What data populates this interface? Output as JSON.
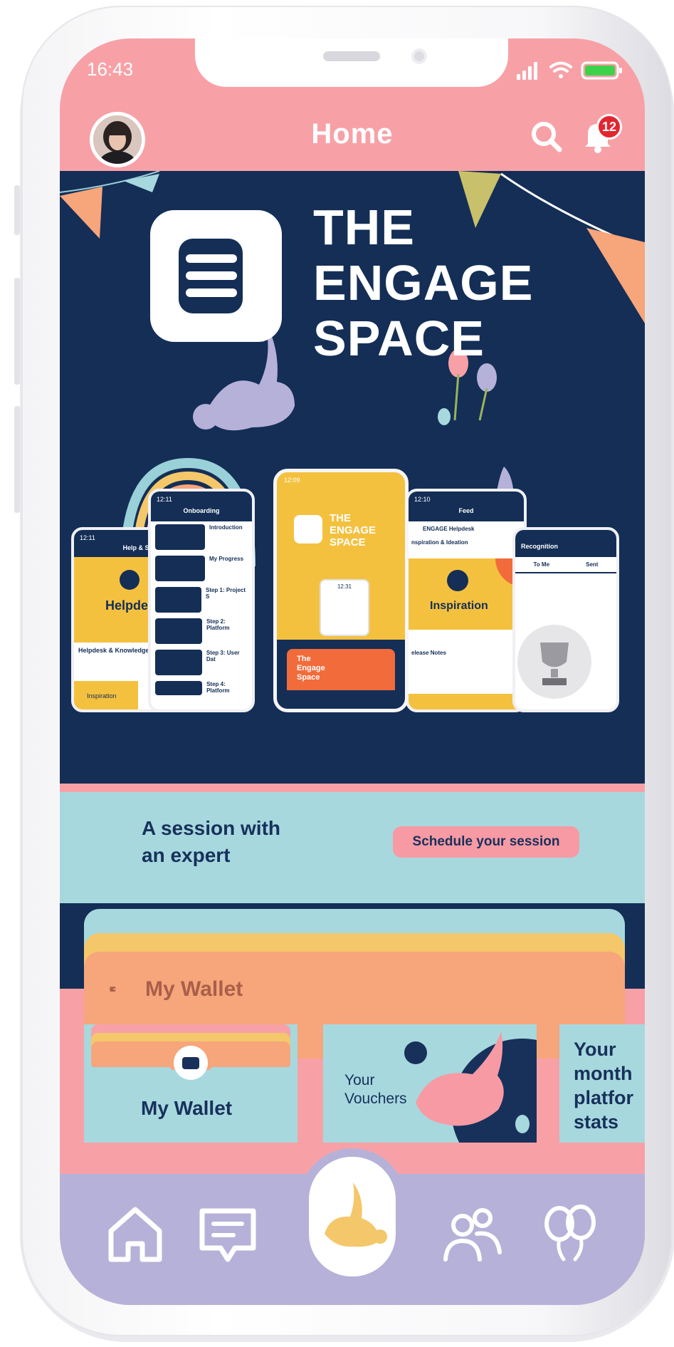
{
  "status_bar": {
    "time": "16:43"
  },
  "header": {
    "title": "Home",
    "notification_count": "12"
  },
  "banner": {
    "brand_line1": "THE",
    "brand_line2": "ENGAGE",
    "brand_line3": "SPACE",
    "mock_screens": {
      "help_title": "Help & Support",
      "help_hero": "Helpdesk",
      "help_item": "Helpdesk & Knowledge Ba",
      "help_footer": "Inspiration",
      "onboarding_title": "Onboarding",
      "onboarding_items": [
        "Introduction",
        "My Progress",
        "Step 1: Project S",
        "Step 2: Platform",
        "Step 3: User Dat",
        "Step 4: Platform"
      ],
      "center_times": [
        "12:09",
        "12:31"
      ],
      "center_brand": [
        "THE",
        "ENGAGE",
        "SPACE"
      ],
      "center_card": [
        "The",
        "Engage",
        "Space"
      ],
      "feed_title": "Feed",
      "feed_author": "ENGAGE Helpdesk",
      "feed_heading": "nspiration & Ideation",
      "feed_hero": "Inspiration",
      "feed_note": "elease Notes",
      "recognition_title": "Recognition",
      "recognition_tabs": [
        "To Me",
        "Sent"
      ],
      "mock_times": [
        "12:11",
        "12:11",
        "12:10"
      ]
    }
  },
  "session": {
    "text_line1": "A session with",
    "text_line2": "an expert",
    "button": "Schedule your session"
  },
  "wallet": {
    "heading": "My Wallet",
    "tiles": [
      {
        "label": "My Wallet"
      },
      {
        "label_line1": "Your",
        "label_line2": "Vouchers"
      },
      {
        "label_line1": "Your",
        "label_line2": "month",
        "label_line3": "platfor",
        "label_line4": "stats"
      }
    ]
  },
  "nav": {
    "items": [
      "home-icon",
      "chat-icon",
      "bunny-icon",
      "people-icon",
      "balloons-icon"
    ]
  },
  "colors": {
    "pink": "#f7a1a7",
    "navy": "#142e56",
    "teal": "#a7d8de",
    "yellow": "#f4c76b",
    "orange": "#f7a57a",
    "lavender": "#b6b1d8"
  }
}
